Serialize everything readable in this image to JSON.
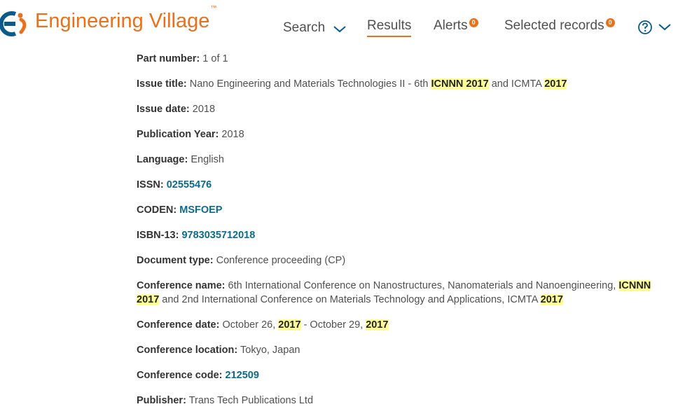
{
  "header": {
    "brand": "Engineering Village",
    "brand_tm": "™",
    "nav": {
      "search": "Search",
      "results": "Results",
      "alerts": "Alerts",
      "alerts_count": "0",
      "selected": "Selected records",
      "selected_count": "0"
    },
    "icons": [
      "ei-logo-icon",
      "chevron-down-icon",
      "help-icon",
      "chevron-down-icon"
    ]
  },
  "record": {
    "part_number": {
      "label": "Part number:",
      "value": "1 of 1"
    },
    "issue_title": {
      "label": "Issue title:",
      "pre": "Nano Engineering and Materials Technologies II - 6th ",
      "hl1": "ICNNN 2017",
      "mid": " and ICMTA ",
      "hl2": "2017"
    },
    "issue_date": {
      "label": "Issue date:",
      "value": "2018"
    },
    "publication_year": {
      "label": "Publication Year:",
      "value": "2018"
    },
    "language": {
      "label": "Language:",
      "value": "English"
    },
    "issn": {
      "label": "ISSN:",
      "value": "02555476"
    },
    "coden": {
      "label": "CODEN:",
      "value": "MSFOEP"
    },
    "isbn": {
      "label": "ISBN-13:",
      "value": "9783035712018"
    },
    "document_type": {
      "label": "Document type:",
      "value": "Conference proceeding (CP)"
    },
    "conference_name": {
      "label": "Conference name:",
      "pre": "6th International Conference on Nanostructures, Nanomaterials and Nanoengineering, ",
      "hl1": "ICNNN",
      "hl2": "2017",
      "mid": " and 2nd International Conference on Materials Technology and Applications, ICMTA ",
      "hl3": "2017"
    },
    "conference_date": {
      "label": "Conference date:",
      "pre": "October 26, ",
      "hl1": "2017",
      "mid": " - October 29, ",
      "hl2": "2017"
    },
    "conference_location": {
      "label": "Conference location:",
      "value": "Tokyo, Japan"
    },
    "conference_code": {
      "label": "Conference code:",
      "value": "212509"
    },
    "publisher": {
      "label": "Publisher:",
      "value": "Trans Tech Publications Ltd"
    }
  },
  "colors": {
    "brand": "#e9711c",
    "link": "#0b6b8e",
    "highlight": "#ffff99",
    "logo_blue": "#0a5a8c"
  }
}
